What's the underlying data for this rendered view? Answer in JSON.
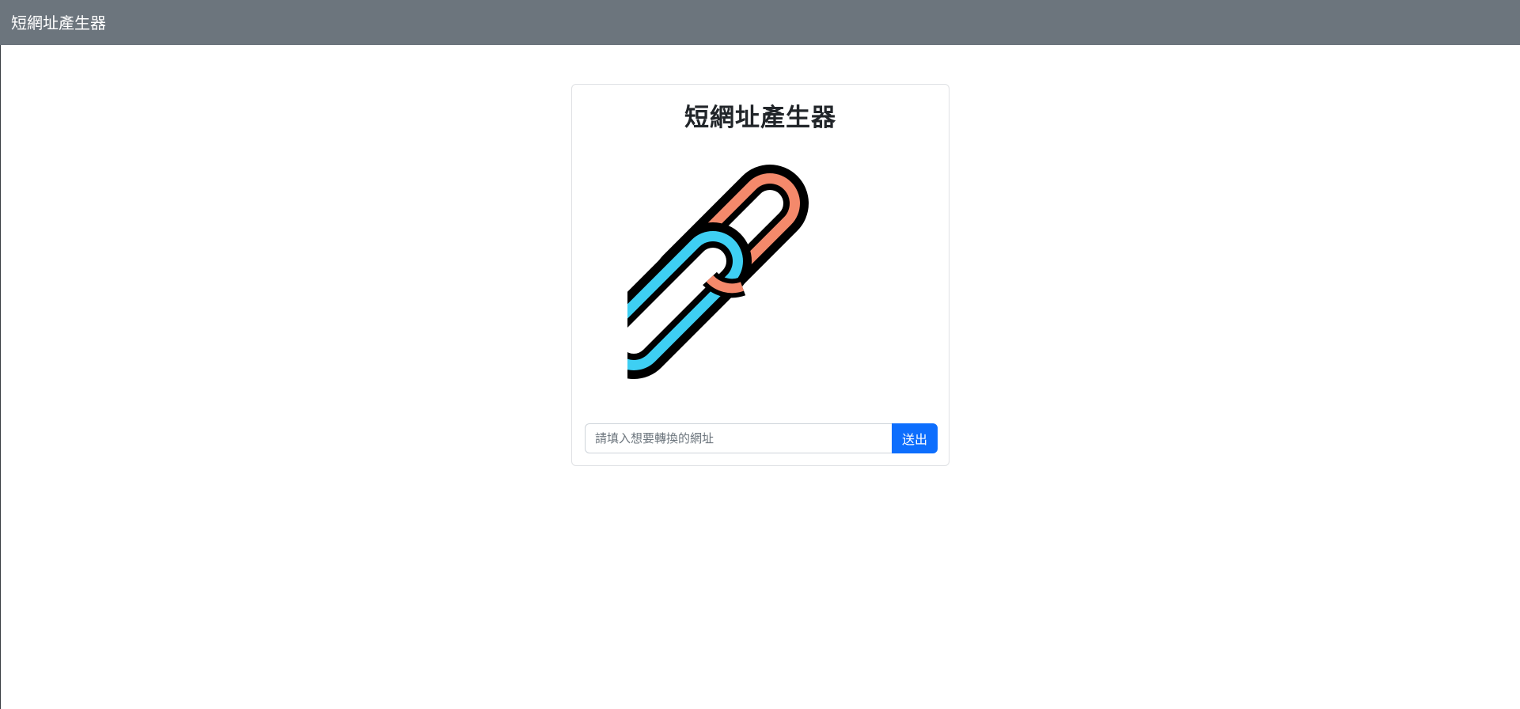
{
  "navbar": {
    "brand": "短網址產生器"
  },
  "card": {
    "title": "短網址產生器",
    "logo_icon": "chain-link-icon",
    "colors": {
      "link_a": "#f4896b",
      "link_b": "#3ecff3",
      "outline": "#000000"
    }
  },
  "form": {
    "placeholder": "請填入想要轉換的網址",
    "value": "",
    "submit_label": "送出"
  },
  "theme": {
    "navbar_bg": "#6c757d",
    "primary": "#0d6efd"
  }
}
